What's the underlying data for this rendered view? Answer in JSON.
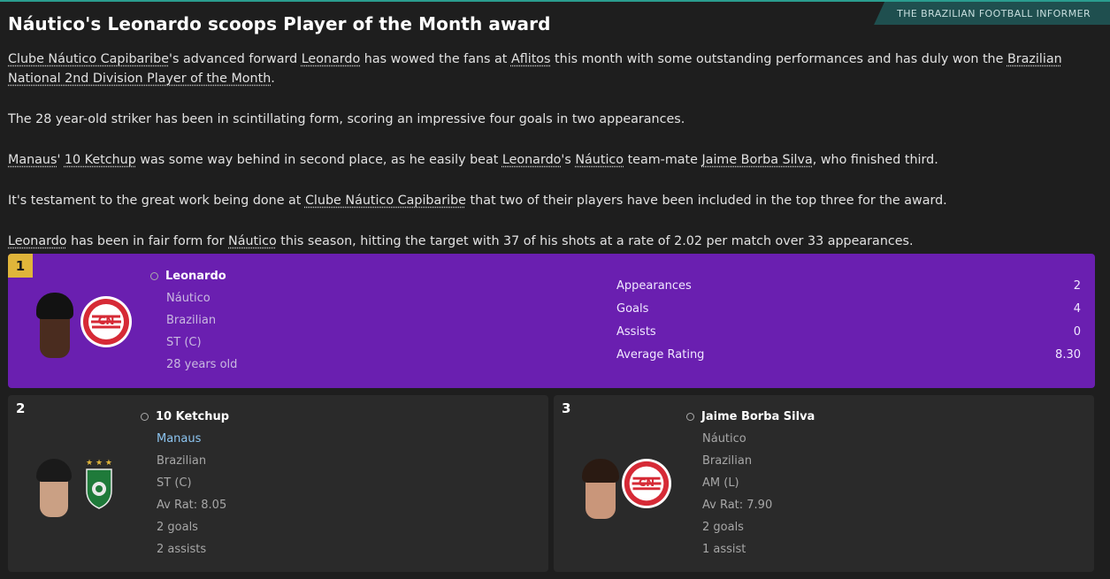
{
  "source_tag": "THE BRAZILIAN FOOTBALL INFORMER",
  "headline": "Náutico's Leonardo scoops Player of the Month award",
  "article": {
    "p1": {
      "a": "Clube Náutico Capibaribe",
      "b": "'s advanced forward ",
      "c": "Leonardo",
      "d": " has wowed the fans at ",
      "e": "Aflitos",
      "f": " this month with some outstanding performances and has duly won the ",
      "g": "Brazilian National 2nd Division Player of the Month",
      "h": "."
    },
    "p2": "The 28 year-old striker has been in scintillating form, scoring an impressive four goals in two appearances.",
    "p3": {
      "a": "Manaus",
      "b": "' ",
      "c": "10 Ketchup",
      "d": " was some way behind in second place, as he easily beat ",
      "e": "Leonardo",
      "f": "'s ",
      "g": "Náutico",
      "h": " team-mate ",
      "i": "Jaime Borba Silva",
      "j": ", who finished third."
    },
    "p4": {
      "a": "It's testament to the great work being done at ",
      "b": "Clube Náutico Capibaribe",
      "c": " that two of their players have been included in the top three for the award."
    },
    "p5": {
      "a": "Leonardo",
      "b": " has been in fair form for ",
      "c": "Náutico",
      "d": " this season, hitting the target with 37 of his shots at a rate of 2.02 per match over 33 appearances."
    }
  },
  "winner": {
    "rank": "1",
    "name": "Leonardo",
    "club": "Náutico",
    "nationality": "Brazilian",
    "position": "ST (C)",
    "age": "28 years old",
    "stats": [
      {
        "label": "Appearances",
        "value": "2"
      },
      {
        "label": "Goals",
        "value": "4"
      },
      {
        "label": "Assists",
        "value": "0"
      },
      {
        "label": "Average Rating",
        "value": "8.30"
      }
    ]
  },
  "second": {
    "rank": "2",
    "name": "10 Ketchup",
    "club": "Manaus",
    "nationality": "Brazilian",
    "position": "ST (C)",
    "av_rat": "Av Rat: 8.05",
    "goals": "2 goals",
    "assists": "2 assists"
  },
  "third": {
    "rank": "3",
    "name": "Jaime Borba Silva",
    "club": "Náutico",
    "nationality": "Brazilian",
    "position": "AM (L)",
    "av_rat": "Av Rat: 7.90",
    "goals": "2 goals",
    "assists": "1 assist"
  },
  "colors": {
    "winner_bg": "#6a1fb0",
    "rank1_badge": "#e0b53a",
    "card_bg": "#2a2a2a",
    "link_blue": "#8cc4f0",
    "nautico_red": "#d62a36",
    "manaus_green": "#1f7a3a"
  },
  "icons": [
    "person-icon",
    "nautico-crest",
    "manaus-crest",
    "player-face"
  ]
}
